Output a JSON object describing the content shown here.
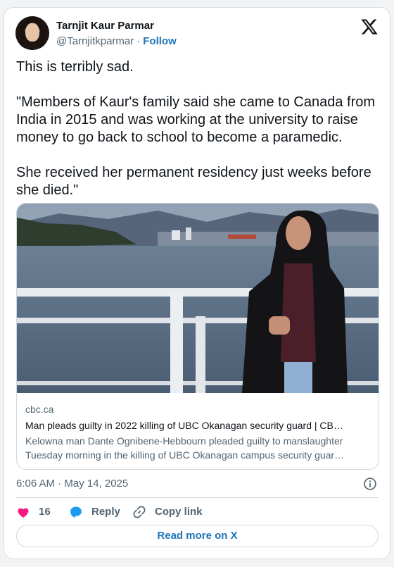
{
  "author": {
    "name": "Tarnjit Kaur Parmar",
    "handle": "@Tarnjitkparmar",
    "separator": "·",
    "follow_label": "Follow"
  },
  "tweet": {
    "paragraphs": [
      "This is terribly sad.",
      "\"Members of Kaur's family said she came to Canada from India in 2015 and was working at the university to raise money to go back to school to become a paramedic.",
      "She received her permanent residency just weeks before she died.\""
    ],
    "timestamp": "6:06 AM · May 14, 2025"
  },
  "link_card": {
    "domain": "cbc.ca",
    "title": "Man pleads guilty in 2022 killing of UBC Okanagan security guard | CB…",
    "description_lines": [
      "Kelowna man Dante Ognibene-Hebbourn pleaded guilty to manslaughter",
      "Tuesday morning in the killing of UBC Okanagan campus security guar…"
    ]
  },
  "actions": {
    "like_count": "16",
    "reply_label": "Reply",
    "copy_label": "Copy link"
  },
  "read_more_label": "Read more on X",
  "colors": {
    "link_blue": "#1d75b8",
    "like_pink": "#f91880",
    "reply_blue": "#1d9bf0",
    "muted_text": "#536471",
    "border": "#cfd9de"
  },
  "icons": [
    "x-logo-icon",
    "info-icon",
    "heart-icon",
    "reply-bubble-icon",
    "link-icon"
  ]
}
